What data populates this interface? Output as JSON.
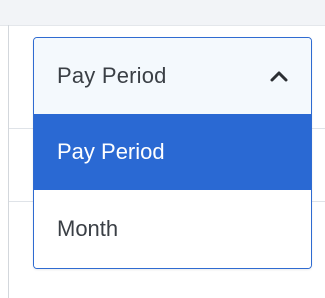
{
  "dropdown": {
    "selected_value": "Pay Period",
    "options": [
      {
        "label": "Pay Period",
        "selected": true
      },
      {
        "label": "Month",
        "selected": false
      }
    ],
    "icon": "chevron-up-icon"
  },
  "colors": {
    "accent": "#2a69d3",
    "border": "#2f6bd1",
    "header_bg": "#f4f9fd",
    "text": "#3a3f45"
  }
}
